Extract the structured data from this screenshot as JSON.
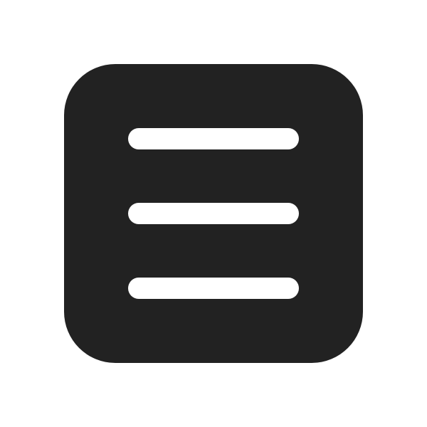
{
  "icon": {
    "name": "hamburger-menu-icon",
    "button_color": "#222222",
    "line_color": "#ffffff",
    "background_color": "#ffffff"
  }
}
